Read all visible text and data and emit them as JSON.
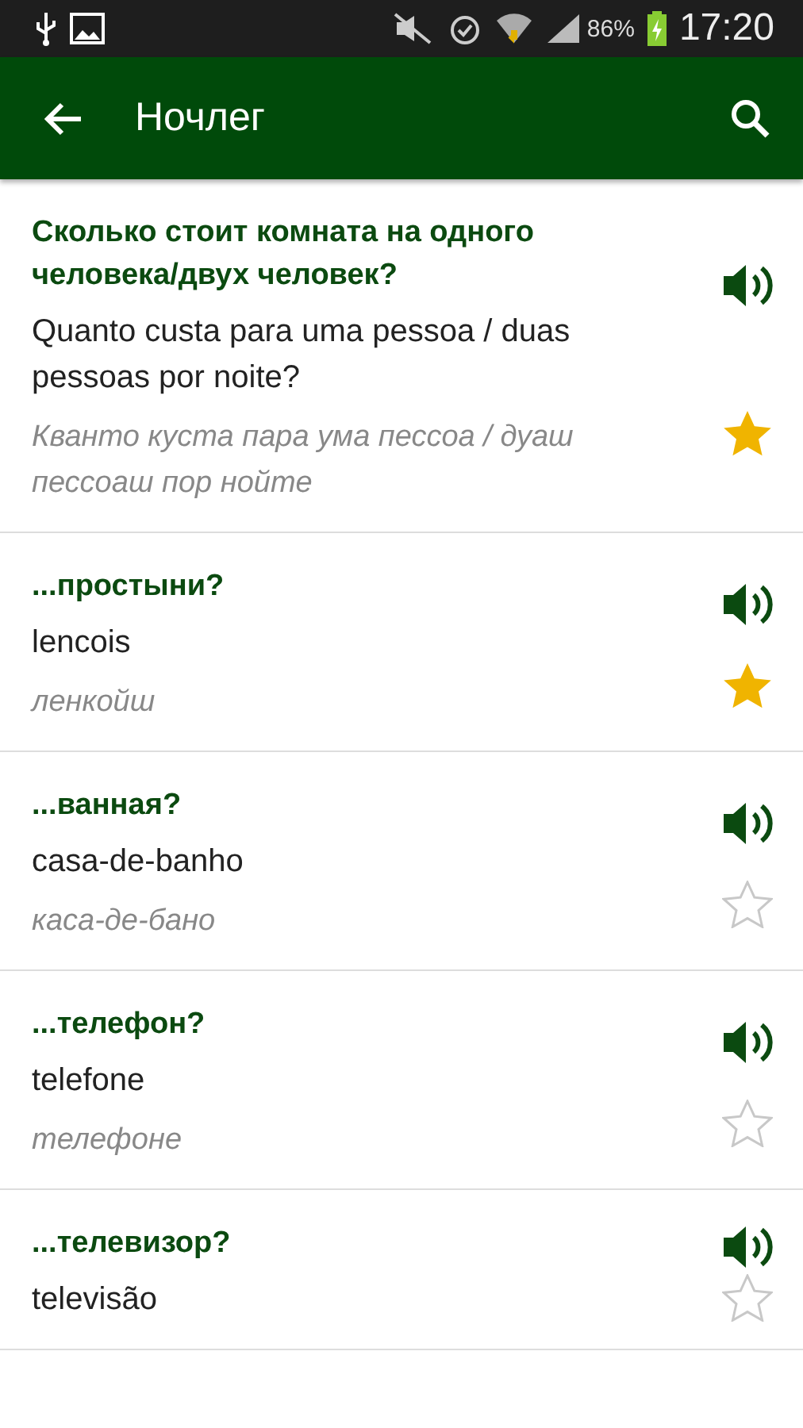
{
  "status_bar": {
    "battery": "86%",
    "time": "17:20"
  },
  "app_bar": {
    "title": "Ночлег"
  },
  "phrases": [
    {
      "phrase": "Сколько стоит комната на одного человека/двух человек?",
      "translation": "Quanto custa para uma pessoa / duas pessoas por noite?",
      "transliteration": "Кванто куста пара ума пессоа / дуаш пессоаш пор нойте",
      "favorite": true
    },
    {
      "phrase": "...простыни?",
      "translation": "lencois",
      "transliteration": "ленкойш",
      "favorite": true
    },
    {
      "phrase": "...ванная?",
      "translation": "casa-de-banho",
      "transliteration": "каса-де-бано",
      "favorite": false
    },
    {
      "phrase": "...телефон?",
      "translation": "telefone",
      "transliteration": "телефоне",
      "favorite": false
    },
    {
      "phrase": "...телевизор?",
      "translation": "televisão",
      "favorite": false
    }
  ]
}
